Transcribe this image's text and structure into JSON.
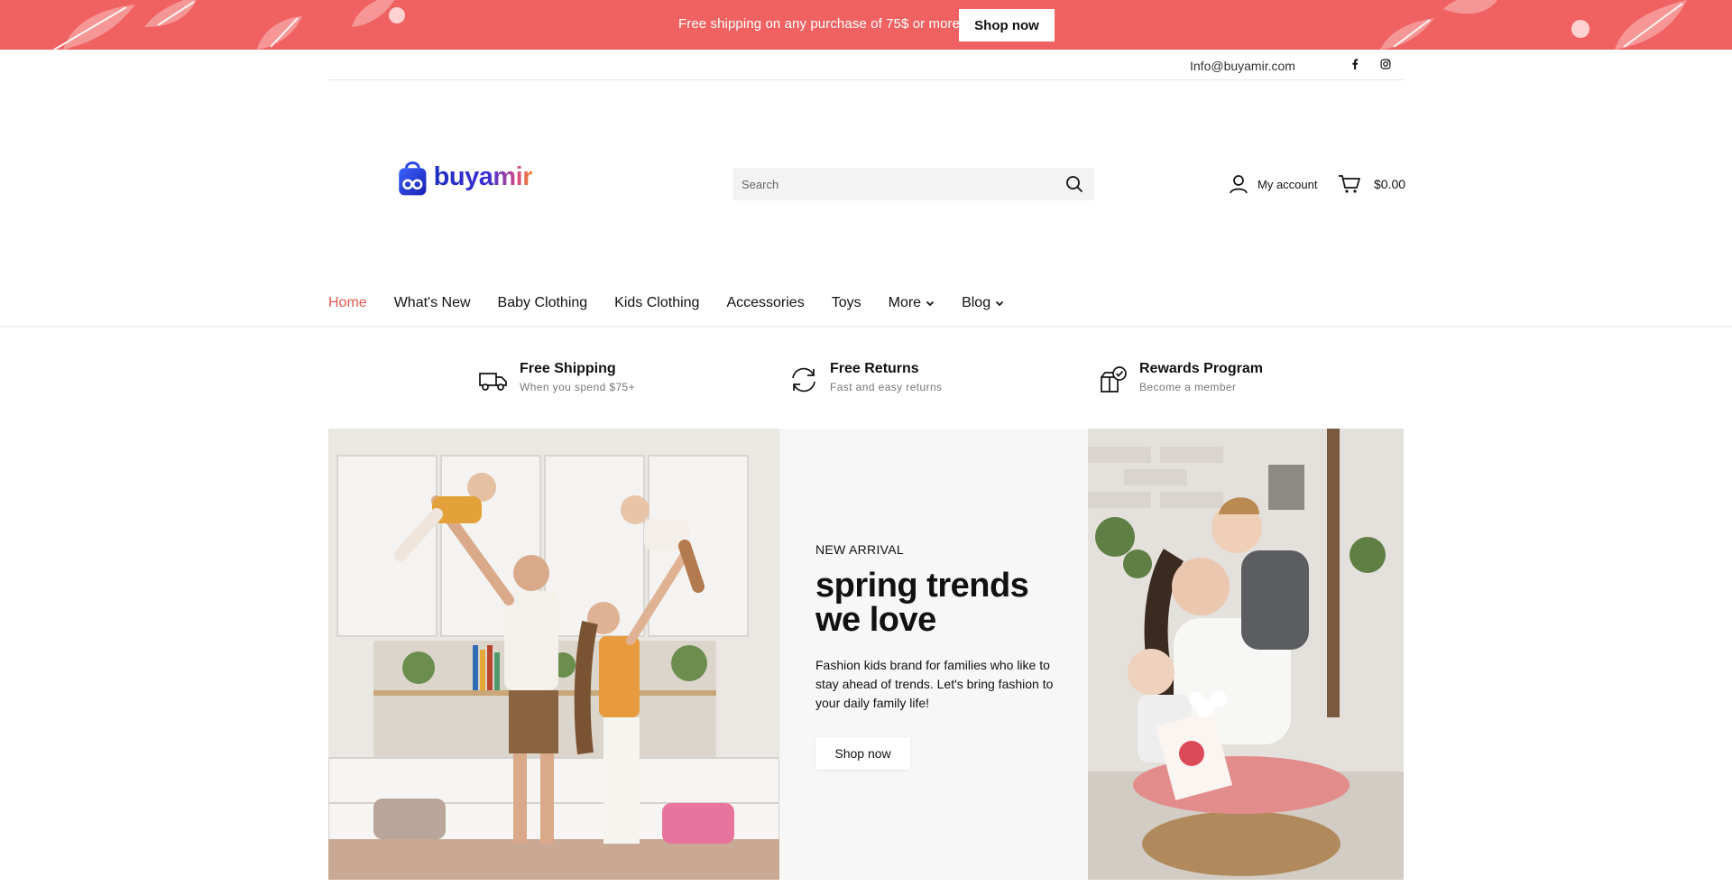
{
  "promo": {
    "text": "Free shipping on any purchase of 75$ or more!",
    "button_label": "Shop now",
    "bg_color": "#f06262"
  },
  "topbar": {
    "email": "Info@buyamir.com",
    "social": [
      "facebook-icon",
      "instagram-icon"
    ]
  },
  "header": {
    "logo_text": "buyamir",
    "search_placeholder": "Search",
    "account_label": "My account",
    "cart_total": "$0.00"
  },
  "nav": {
    "items": [
      {
        "label": "Home",
        "active": true
      },
      {
        "label": "What's New"
      },
      {
        "label": "Baby Clothing"
      },
      {
        "label": "Kids Clothing"
      },
      {
        "label": "Accessories"
      },
      {
        "label": "Toys"
      },
      {
        "label": "More",
        "dropdown": true
      },
      {
        "label": "Blog",
        "dropdown": true
      }
    ],
    "active_color": "#e4584e"
  },
  "features": [
    {
      "title": "Free Shipping",
      "subtitle": "When you spend $75+",
      "icon": "truck-icon"
    },
    {
      "title": "Free Returns",
      "subtitle": "Fast and easy returns",
      "icon": "returns-icon"
    },
    {
      "title": "Rewards Program",
      "subtitle": "Become a member",
      "icon": "gift-icon"
    }
  ],
  "hero": {
    "eyebrow": "NEW ARRIVAL",
    "headline": "spring trends we love",
    "description": "Fashion kids brand for families who like to stay ahead of trends. Let's bring fashion to your daily family life!",
    "cta_label": "Shop now"
  }
}
